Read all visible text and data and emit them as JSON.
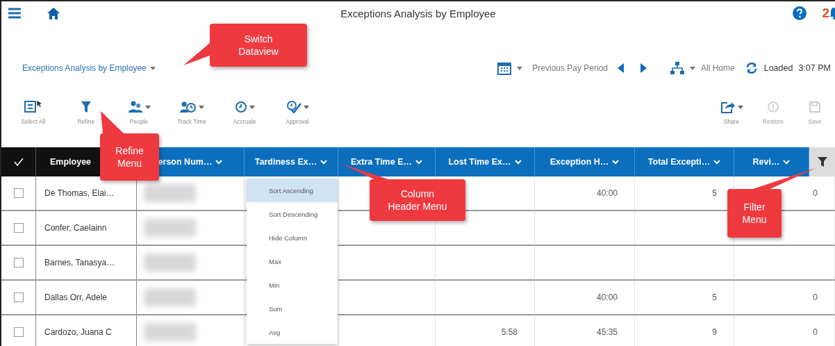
{
  "header": {
    "title": "Exceptions Analysis by Employee",
    "notification_count": "2"
  },
  "dataview": {
    "label": "Exceptions Analysis by Employee"
  },
  "context": {
    "period": "Previous Pay Period",
    "location": "All Home",
    "status": "Loaded",
    "time": "3:07 PM"
  },
  "toolbar": [
    {
      "label": "Select All",
      "kind": "select",
      "dropdown": false,
      "disabled": false
    },
    {
      "label": "Refine",
      "kind": "filter",
      "dropdown": false,
      "disabled": false
    },
    {
      "label": "People",
      "kind": "people",
      "dropdown": true,
      "disabled": false
    },
    {
      "label": "Track Time",
      "kind": "track",
      "dropdown": true,
      "disabled": false
    },
    {
      "label": "Accruals",
      "kind": "clock",
      "dropdown": true,
      "disabled": false
    },
    {
      "label": "Approval",
      "kind": "approval",
      "dropdown": true,
      "disabled": false
    }
  ],
  "actions": [
    {
      "label": "Share",
      "kind": "share",
      "dropdown": true,
      "disabled": false
    },
    {
      "label": "Restore",
      "kind": "restore",
      "dropdown": false,
      "disabled": true
    },
    {
      "label": "Save",
      "kind": "save",
      "dropdown": false,
      "disabled": true
    }
  ],
  "table": {
    "columns": [
      {
        "label": "Employee",
        "frozen": true
      },
      {
        "label": "erson Num…",
        "frozen": false
      },
      {
        "label": "Tardiness Ex…",
        "frozen": false
      },
      {
        "label": "Extra Time E…",
        "frozen": false
      },
      {
        "label": "Lost Time Ex…",
        "frozen": false
      },
      {
        "label": "Exception H…",
        "frozen": false
      },
      {
        "label": "Total Excepti…",
        "frozen": false
      },
      {
        "label": "Revi…",
        "frozen": false
      }
    ],
    "rows": [
      {
        "checked": false,
        "employee": "De Thomas, Elai…",
        "cells": [
          null,
          null,
          null,
          "40:00",
          "5",
          "0"
        ]
      },
      {
        "checked": false,
        "employee": "Confer, Caelainn",
        "cells": [
          null,
          null,
          null,
          null,
          null,
          null
        ]
      },
      {
        "checked": false,
        "employee": "Barnes, Tanasya…",
        "cells": [
          null,
          null,
          null,
          null,
          null,
          null
        ]
      },
      {
        "checked": false,
        "employee": "Dallas Orr, Adele",
        "cells": [
          null,
          null,
          null,
          "40:00",
          "5",
          "0"
        ]
      },
      {
        "checked": false,
        "employee": "Cardozo, Juana C",
        "cells": [
          null,
          null,
          "5.58",
          "45:35",
          "9",
          "0"
        ]
      }
    ]
  },
  "column_menu": {
    "items": [
      {
        "label": "Sort Ascending",
        "selected": true
      },
      {
        "label": "Sort Descending",
        "selected": false
      },
      {
        "label": "Hide Column",
        "selected": false
      },
      {
        "label": "Max",
        "selected": false
      },
      {
        "label": "Min",
        "selected": false
      },
      {
        "label": "Sum",
        "selected": false
      },
      {
        "label": "Avg",
        "selected": false
      }
    ]
  },
  "callouts": [
    {
      "text": "Switch Dataview"
    },
    {
      "text": "Refine Menu"
    },
    {
      "text": "Column Header Menu"
    },
    {
      "text": "Filter Menu"
    }
  ]
}
